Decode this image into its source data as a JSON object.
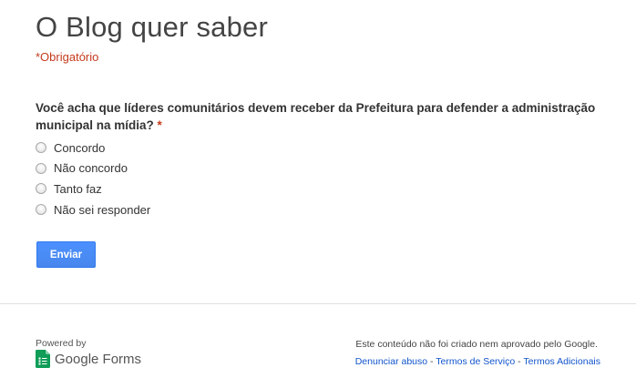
{
  "form": {
    "title": "O Blog quer saber",
    "required_note": "*Obrigatório",
    "question": {
      "text": "Você acha que líderes comunitários devem receber da Prefeitura para defender a administração municipal na mídia?",
      "required_marker": "*",
      "options": [
        "Concordo",
        "Não concordo",
        "Tanto faz",
        "Não sei responder"
      ]
    },
    "submit_label": "Enviar"
  },
  "footer": {
    "powered_by": "Powered by",
    "brand_google": "Google",
    "brand_forms": "Forms",
    "disclaimer": "Este conteúdo não foi criado nem aprovado pelo Google.",
    "links": {
      "report_abuse": "Denunciar abuso",
      "terms_of_service": "Termos de Serviço",
      "additional_terms": "Termos Adicionais",
      "separator": " - "
    }
  },
  "colors": {
    "required": "#c43b1d",
    "button": "#4d90fe",
    "link": "#1155cc",
    "forms_icon": "#0f9d58"
  },
  "icons": {
    "forms_logo": "google-forms-icon"
  }
}
